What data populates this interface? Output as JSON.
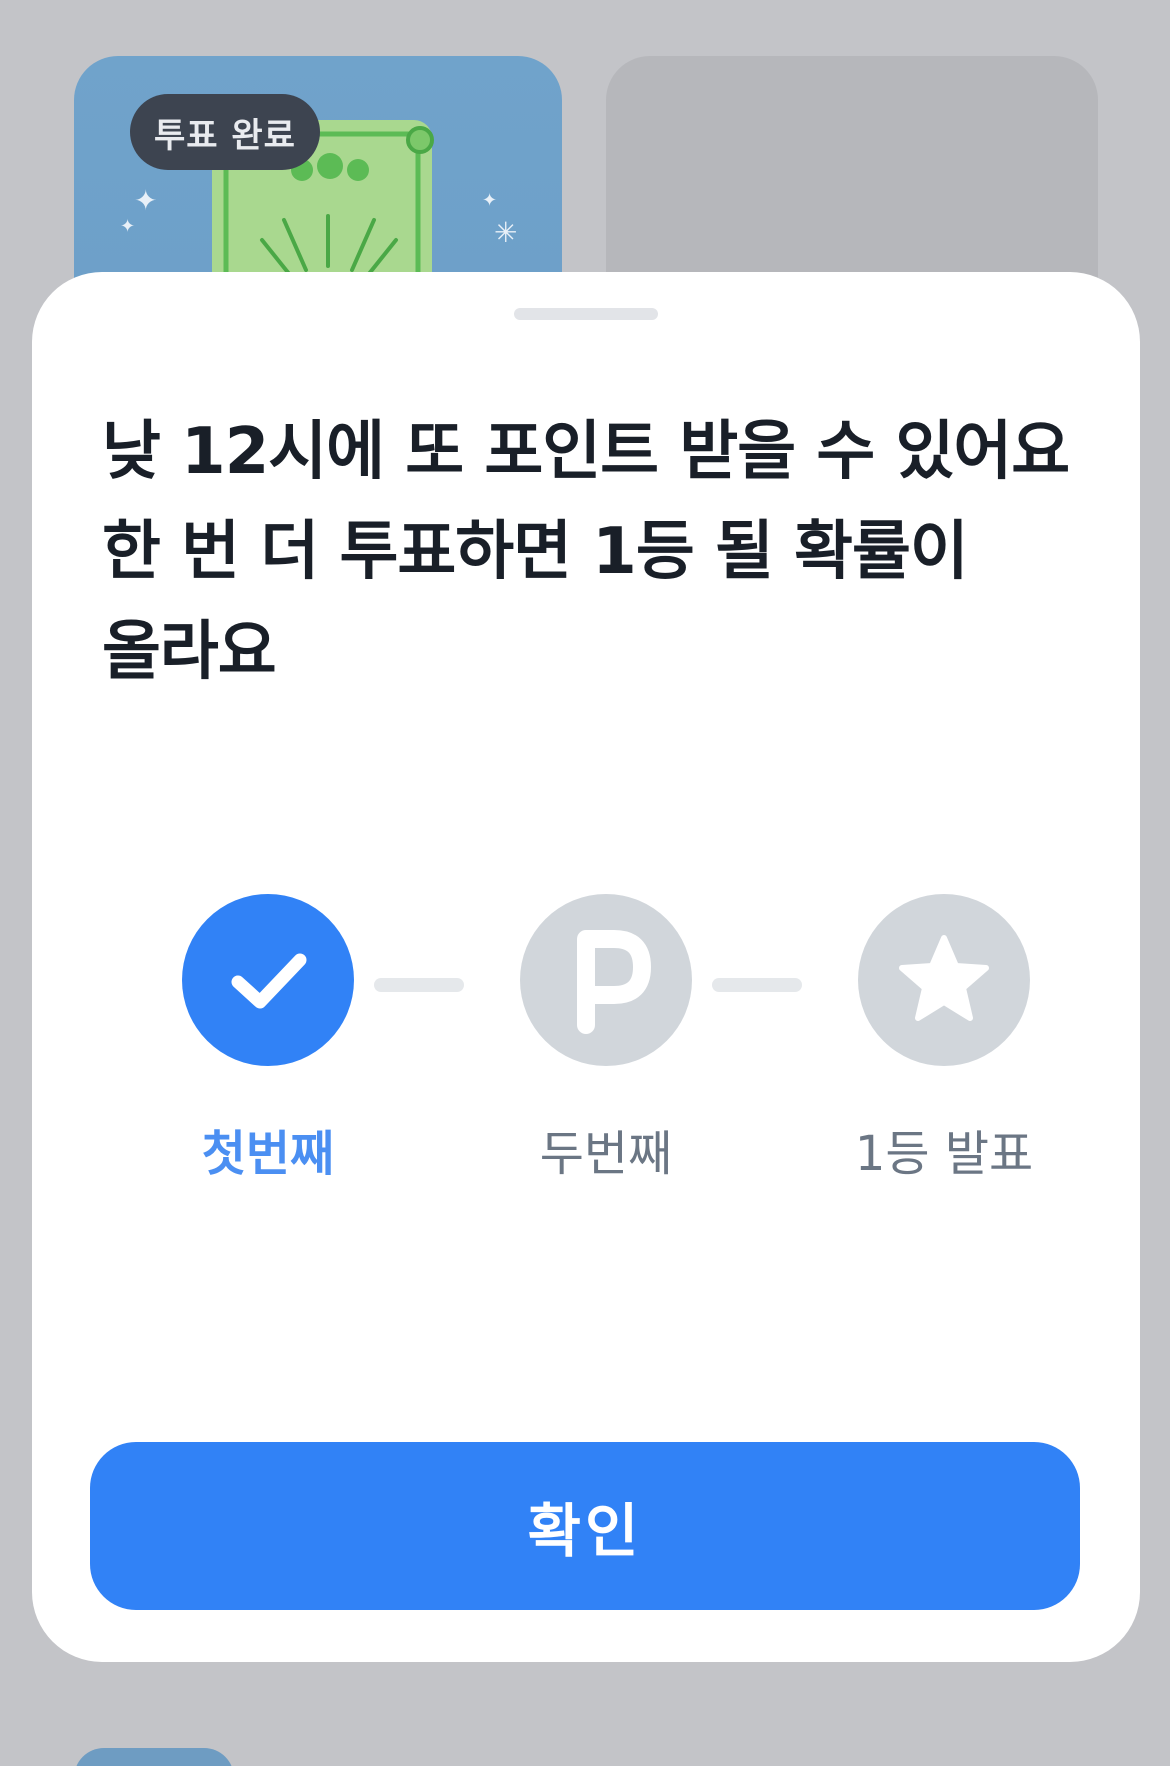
{
  "background": {
    "vote_card": {
      "badge": "투표 완료"
    }
  },
  "sheet": {
    "title_lines": [
      "낮 12시에 또 포인트 받을 수 있어요",
      "한 번 더 투표하면 1등 될 확률이",
      "올라요"
    ],
    "steps": [
      {
        "label": "첫번째",
        "icon": "check-icon",
        "state": "active"
      },
      {
        "label": "두번째",
        "icon": "point-p-icon",
        "state": "inactive"
      },
      {
        "label": "1등 발표",
        "icon": "star-icon",
        "state": "inactive"
      }
    ],
    "confirm_label": "확인"
  },
  "colors": {
    "accent": "#3182f6",
    "inactive": "#d1d6db",
    "title": "#191f28"
  }
}
